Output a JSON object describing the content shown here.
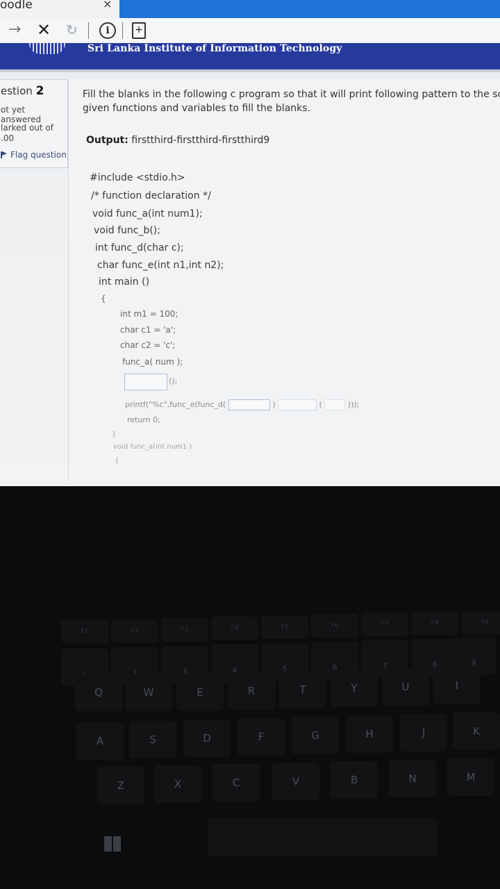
{
  "browser": {
    "tab_title": "oodle",
    "tab_close": "×",
    "toolbar": {
      "forward_icon": "→",
      "stop_icon": "✕",
      "reload_icon": "↻",
      "info_icon": "i",
      "page_icon": "+"
    },
    "accent_color": "#1e73d8"
  },
  "site": {
    "name": "Sri Lanka Institute of Information Technology",
    "header_color": "#263a9e"
  },
  "question_info": {
    "number_prefix": "estion",
    "number": "2",
    "status": "ot yet answered",
    "marked_line1": "larked out of",
    "marked_line2": ".00",
    "flag_label": "Flag question"
  },
  "question": {
    "text_line1": "Fill the blanks in the following c program so that it will print following pattern to the screen. N",
    "text_line2": "given functions and variables to fill the blanks.",
    "output_label": "Output:",
    "output_value": "firstthird-firstthird-firstthird9",
    "code": {
      "l1": "#include <stdio.h>",
      "l2": "/* function declaration */",
      "l3": "void func_a(int num1);",
      "l4": "void func_b();",
      "l5": "int func_d(char c);",
      "l6": "char func_e(int n1,int n2);",
      "l7": "int main ()",
      "l8": "{",
      "l9": "int m1 = 100;",
      "l10": "char c1 = 'a';",
      "l11": "char c2 = 'c';",
      "l12": "func_a( num );",
      "l13_suffix": "();",
      "l14": "printf(\"%c\",func_e(func_d(",
      "l14_mid": ")",
      "l14_mid2": "(",
      "l14_end": ")));",
      "l15": "return 0;",
      "l16": "}",
      "l17": "void func_a(int num1 )",
      "l18": "{"
    }
  },
  "keyboard": {
    "fn_row": [
      "F1",
      "F2",
      "F3",
      "F4",
      "F5",
      "F6",
      "F7",
      "F8",
      "F9"
    ],
    "num_row": [
      "!",
      "2",
      "3",
      "4",
      "5",
      "6",
      "7",
      "8",
      "9"
    ],
    "row_q": [
      "Q",
      "W",
      "E",
      "R",
      "T",
      "Y",
      "U",
      "I"
    ],
    "row_a": [
      "A",
      "S",
      "D",
      "F",
      "G",
      "H",
      "J",
      "K"
    ],
    "row_z": [
      "Z",
      "X",
      "C",
      "V",
      "B",
      "N",
      "M"
    ]
  }
}
